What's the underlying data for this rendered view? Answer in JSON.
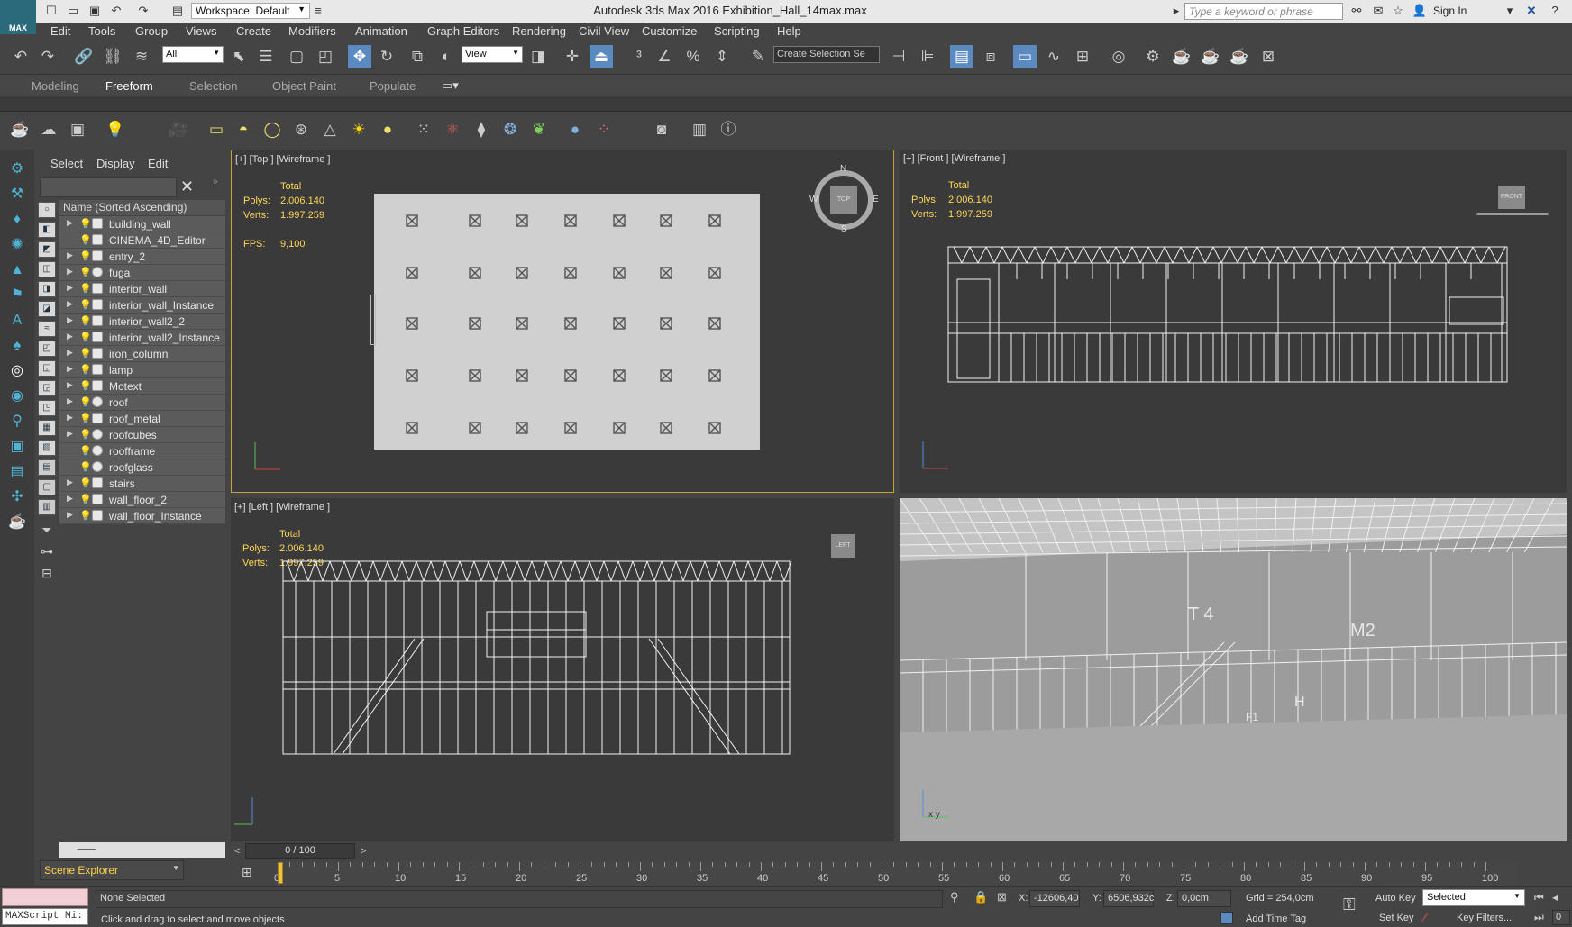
{
  "app": {
    "logo_text": "MAX",
    "workspace": "Workspace: Default",
    "title": "Autodesk 3ds Max 2016     Exhibition_Hall_14max.max",
    "search_placeholder": "Type a keyword or phrase",
    "sign_in": "Sign In"
  },
  "menu": [
    "Edit",
    "Tools",
    "Group",
    "Views",
    "Create",
    "Modifiers",
    "Animation",
    "Graph Editors",
    "Rendering",
    "Civil View",
    "Customize",
    "Scripting",
    "Help"
  ],
  "toolbar": {
    "filter_select": "All",
    "ref_coord": "View",
    "selection_set_placeholder": "Create Selection Se"
  },
  "ribbon_tabs": [
    "Modeling",
    "Freeform",
    "Selection",
    "Object Paint",
    "Populate"
  ],
  "ribbon_active": "Freeform",
  "scene_explorer": {
    "tabs": [
      "Select",
      "Display",
      "Edit"
    ],
    "column_header": "Name (Sorted Ascending)",
    "items": [
      {
        "name": "building_wall",
        "expandable": true,
        "type": "mesh"
      },
      {
        "name": "CINEMA_4D_Editor",
        "expandable": false,
        "type": "group"
      },
      {
        "name": "entry_2",
        "expandable": true,
        "type": "mesh"
      },
      {
        "name": "fuga",
        "expandable": true,
        "type": "sphere"
      },
      {
        "name": "interior_wall",
        "expandable": true,
        "type": "mesh"
      },
      {
        "name": "interior_wall_Instance",
        "expandable": true,
        "type": "mesh"
      },
      {
        "name": "interior_wall2_2",
        "expandable": true,
        "type": "mesh"
      },
      {
        "name": "interior_wall2_Instance",
        "expandable": true,
        "type": "mesh"
      },
      {
        "name": "iron_column",
        "expandable": true,
        "type": "mesh"
      },
      {
        "name": "lamp",
        "expandable": true,
        "type": "mesh"
      },
      {
        "name": "Motext",
        "expandable": true,
        "type": "mesh"
      },
      {
        "name": "roof",
        "expandable": true,
        "type": "sphere"
      },
      {
        "name": "roof_metal",
        "expandable": true,
        "type": "mesh"
      },
      {
        "name": "roofcubes",
        "expandable": true,
        "type": "sphere"
      },
      {
        "name": "roofframe",
        "expandable": false,
        "type": "sphere"
      },
      {
        "name": "roofglass",
        "expandable": false,
        "type": "sphere"
      },
      {
        "name": "stairs",
        "expandable": true,
        "type": "mesh"
      },
      {
        "name": "wall_floor_2",
        "expandable": true,
        "type": "mesh"
      },
      {
        "name": "wall_floor_Instance",
        "expandable": true,
        "type": "mesh"
      }
    ],
    "footer": "Scene Explorer"
  },
  "viewports": {
    "top": {
      "label": "[+] [Top ] [Wireframe ]",
      "total": "Total",
      "polys_label": "Polys:",
      "polys": "2.006.140",
      "verts_label": "Verts:",
      "verts": "1.997.259",
      "fps_label": "FPS:",
      "fps": "9,100",
      "viewcube": "TOP",
      "compass": [
        "N",
        "E",
        "S",
        "W"
      ]
    },
    "front": {
      "label": "[+] [Front ] [Wireframe ]",
      "total": "Total",
      "polys_label": "Polys:",
      "polys": "2.006.140",
      "verts_label": "Verts:",
      "verts": "1.997.259",
      "viewcube": "FRONT"
    },
    "left": {
      "label": "[+] [Left ] [Wireframe ]",
      "total": "Total",
      "polys_label": "Polys:",
      "polys": "2.006.140",
      "verts_label": "Verts:",
      "verts": "1.997.259",
      "viewcube": "LEFT"
    },
    "persp": {
      "signs": [
        "T 4",
        "M2",
        "H",
        "F1"
      ]
    }
  },
  "timeline": {
    "frame": "0 / 100",
    "ticks": [
      "0",
      "5",
      "10",
      "15",
      "20",
      "25",
      "30",
      "35",
      "40",
      "45",
      "50",
      "55",
      "60",
      "65",
      "70",
      "75",
      "80",
      "85",
      "90",
      "95",
      "100"
    ]
  },
  "status": {
    "selection": "None Selected",
    "prompt": "Click and drag to select and move objects",
    "maxscript": "MAXScript Mi:",
    "x_label": "X:",
    "x": "-12606,40",
    "y_label": "Y:",
    "y": "6506,932c",
    "z_label": "Z:",
    "z": "0,0cm",
    "grid": "Grid = 254,0cm",
    "add_time_tag": "Add Time Tag",
    "auto_key": "Auto Key",
    "key_mode": "Selected",
    "set_key": "Set Key",
    "key_filters": "Key Filters...",
    "frame_field": "0"
  },
  "colors": {
    "viewport_bg": "#3a3a3a",
    "active_border": "#c8a23c",
    "stats_text": "#ffd65a",
    "wire": "#f2f2f2",
    "scene_row": "#5b5b5b"
  }
}
